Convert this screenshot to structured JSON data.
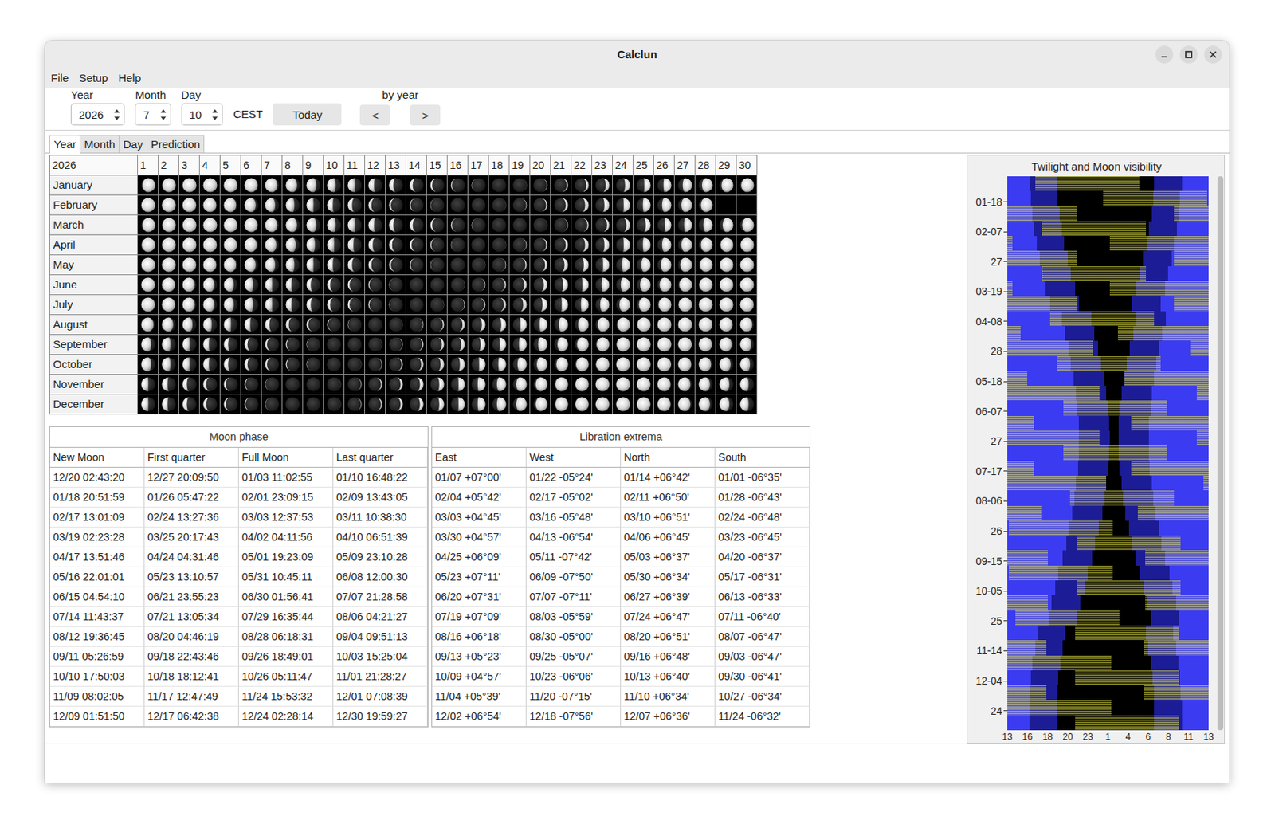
{
  "window": {
    "title": "Calclun"
  },
  "menu": [
    "File",
    "Setup",
    "Help"
  ],
  "toolbar": {
    "fields": [
      {
        "label": "Year",
        "value": "2026"
      },
      {
        "label": "Month",
        "value": "7"
      },
      {
        "label": "Day",
        "value": "10"
      }
    ],
    "timezone": "CEST",
    "today_button": "Today",
    "by_year": {
      "label": "by year",
      "prev": "<",
      "next": ">"
    }
  },
  "tabs": [
    {
      "label": "Year",
      "selected": true
    },
    {
      "label": "Month",
      "selected": false
    },
    {
      "label": "Day",
      "selected": false
    },
    {
      "label": "Prediction",
      "selected": false
    }
  ],
  "year_grid": {
    "corner": "2026",
    "days": [
      "1",
      "2",
      "3",
      "4",
      "5",
      "6",
      "7",
      "8",
      "9",
      "10",
      "11",
      "12",
      "13",
      "14",
      "15",
      "16",
      "17",
      "18",
      "19",
      "20",
      "21",
      "22",
      "23",
      "24",
      "25",
      "26",
      "27",
      "28",
      "29",
      "30"
    ],
    "months": [
      {
        "name": "January",
        "ages": [
          12,
          13,
          14,
          15,
          16,
          17,
          18,
          19,
          20,
          21,
          22,
          23,
          24,
          25,
          26,
          27,
          28,
          29,
          1,
          2,
          3,
          4,
          5,
          6,
          7,
          8,
          9,
          10,
          11,
          12
        ]
      },
      {
        "name": "February",
        "ages": [
          14,
          15,
          16,
          17,
          18,
          19,
          20,
          21,
          22,
          23,
          24,
          25,
          26,
          27,
          28,
          29,
          0,
          1,
          2,
          3,
          4,
          5,
          6,
          7,
          8,
          9,
          10,
          11,
          null,
          null
        ]
      },
      {
        "name": "March",
        "ages": [
          12,
          13,
          14,
          15,
          16,
          17,
          18,
          19,
          20,
          21,
          22,
          23,
          24,
          25,
          26,
          27,
          28,
          29,
          0,
          1,
          2,
          3,
          4,
          5,
          6,
          7,
          8,
          9,
          10,
          11
        ]
      },
      {
        "name": "April",
        "ages": [
          13,
          14,
          15,
          16,
          17,
          18,
          19,
          20,
          21,
          22,
          23,
          24,
          25,
          26,
          27,
          28,
          29,
          1,
          2,
          3,
          4,
          5,
          6,
          7,
          8,
          9,
          10,
          11,
          12,
          13
        ]
      },
      {
        "name": "May",
        "ages": [
          14,
          15,
          16,
          17,
          18,
          19,
          20,
          21,
          22,
          23,
          24,
          25,
          26,
          27,
          28,
          29,
          1,
          2,
          3,
          4,
          5,
          6,
          7,
          8,
          9,
          10,
          11,
          12,
          13,
          14
        ]
      },
      {
        "name": "June",
        "ages": [
          16,
          17,
          18,
          19,
          20,
          21,
          22,
          23,
          24,
          25,
          26,
          27,
          28,
          29,
          0,
          1,
          2,
          3,
          4,
          5,
          6,
          7,
          8,
          9,
          10,
          11,
          12,
          13,
          14,
          15
        ]
      },
      {
        "name": "July",
        "ages": [
          16,
          17,
          18,
          19,
          20,
          21,
          22,
          23,
          24,
          25,
          26,
          27,
          28,
          0,
          1,
          2,
          3,
          4,
          5,
          6,
          7,
          8,
          9,
          10,
          11,
          12,
          13,
          14,
          15,
          16
        ]
      },
      {
        "name": "August",
        "ages": [
          18,
          19,
          20,
          21,
          22,
          23,
          24,
          25,
          26,
          27,
          28,
          29,
          1,
          2,
          3,
          4,
          5,
          6,
          7,
          8,
          9,
          10,
          11,
          12,
          13,
          14,
          15,
          16,
          17,
          18
        ]
      },
      {
        "name": "September",
        "ages": [
          20,
          21,
          22,
          23,
          24,
          25,
          26,
          27,
          28,
          29,
          0,
          1,
          2,
          3,
          4,
          5,
          6,
          7,
          8,
          9,
          10,
          11,
          12,
          13,
          14,
          15,
          16,
          17,
          18,
          19
        ]
      },
      {
        "name": "October",
        "ages": [
          20,
          21,
          22,
          23,
          24,
          25,
          26,
          27,
          28,
          29,
          1,
          2,
          3,
          4,
          5,
          6,
          7,
          8,
          9,
          10,
          11,
          12,
          13,
          14,
          15,
          16,
          17,
          18,
          19,
          20
        ]
      },
      {
        "name": "November",
        "ages": [
          22,
          23,
          24,
          25,
          26,
          27,
          28,
          29,
          0,
          1,
          2,
          3,
          4,
          5,
          6,
          7,
          8,
          9,
          10,
          11,
          12,
          13,
          14,
          15,
          16,
          17,
          18,
          19,
          20,
          21
        ]
      },
      {
        "name": "December",
        "ages": [
          22,
          23,
          24,
          25,
          26,
          27,
          28,
          29,
          0,
          1,
          2,
          3,
          4,
          5,
          6,
          7,
          8,
          9,
          10,
          11,
          12,
          13,
          14,
          15,
          16,
          17,
          18,
          19,
          20,
          21
        ]
      }
    ]
  },
  "moon_phase": {
    "title": "Moon phase",
    "columns": [
      "New Moon",
      "First quarter",
      "Full Moon",
      "Last quarter"
    ],
    "rows": [
      [
        "12/20 02:43:20",
        "12/27 20:09:50",
        "01/03 11:02:55",
        "01/10 16:48:22"
      ],
      [
        "01/18 20:51:59",
        "01/26 05:47:22",
        "02/01 23:09:15",
        "02/09 13:43:05"
      ],
      [
        "02/17 13:01:09",
        "02/24 13:27:36",
        "03/03 12:37:53",
        "03/11 10:38:30"
      ],
      [
        "03/19 02:23:28",
        "03/25 20:17:43",
        "04/02 04:11:56",
        "04/10 06:51:39"
      ],
      [
        "04/17 13:51:46",
        "04/24 04:31:46",
        "05/01 19:23:09",
        "05/09 23:10:28"
      ],
      [
        "05/16 22:01:01",
        "05/23 13:10:57",
        "05/31 10:45:11",
        "06/08 12:00:30"
      ],
      [
        "06/15 04:54:10",
        "06/21 23:55:23",
        "06/30 01:56:41",
        "07/07 21:28:58"
      ],
      [
        "07/14 11:43:37",
        "07/21 13:05:34",
        "07/29 16:35:44",
        "08/06 04:21:27"
      ],
      [
        "08/12 19:36:45",
        "08/20 04:46:19",
        "08/28 06:18:31",
        "09/04 09:51:13"
      ],
      [
        "09/11 05:26:59",
        "09/18 22:43:46",
        "09/26 18:49:01",
        "10/03 15:25:04"
      ],
      [
        "10/10 17:50:03",
        "10/18 18:12:41",
        "10/26 05:11:47",
        "11/01 21:28:27"
      ],
      [
        "11/09 08:02:05",
        "11/17 12:47:49",
        "11/24 15:53:32",
        "12/01 07:08:39"
      ],
      [
        "12/09 01:51:50",
        "12/17 06:42:38",
        "12/24 02:28:14",
        "12/30 19:59:27"
      ]
    ]
  },
  "libration": {
    "title": "Libration extrema",
    "columns": [
      "East",
      "West",
      "North",
      "South"
    ],
    "rows": [
      [
        "01/07 +07°00'",
        "01/22 -05°24'",
        "01/14 +06°42'",
        "01/01 -06°35'"
      ],
      [
        "02/04 +05°42'",
        "02/17 -05°02'",
        "02/11 +06°50'",
        "01/28 -06°43'"
      ],
      [
        "03/03 +04°45'",
        "03/16 -05°48'",
        "03/10 +06°51'",
        "02/24 -06°48'"
      ],
      [
        "03/30 +04°57'",
        "04/13 -06°54'",
        "04/06 +06°45'",
        "03/23 -06°45'"
      ],
      [
        "04/25 +06°09'",
        "05/11 -07°42'",
        "05/03 +06°37'",
        "04/20 -06°37'"
      ],
      [
        "05/23 +07°11'",
        "06/09 -07°50'",
        "05/30 +06°34'",
        "05/17 -06°31'"
      ],
      [
        "06/20 +07°31'",
        "07/07 -07°11'",
        "06/27 +06°39'",
        "06/13 -06°33'"
      ],
      [
        "07/19 +07°09'",
        "08/03 -05°59'",
        "07/24 +06°47'",
        "07/11 -06°40'"
      ],
      [
        "08/16 +06°18'",
        "08/30 -05°00'",
        "08/20 +06°51'",
        "08/07 -06°47'"
      ],
      [
        "09/13 +05°23'",
        "09/25 -05°07'",
        "09/16 +06°48'",
        "09/03 -06°47'"
      ],
      [
        "10/09 +04°57'",
        "10/23 -06°06'",
        "10/13 +06°40'",
        "09/30 -06°41'"
      ],
      [
        "11/04 +05°39'",
        "11/20 -07°15'",
        "11/10 +06°34'",
        "10/27 -06°34'"
      ],
      [
        "12/02 +06°54'",
        "12/18 -07°56'",
        "12/07 +06°36'",
        "11/24 -06°32'"
      ]
    ]
  },
  "twilight_chart": {
    "title": "Twilight and Moon visibility",
    "y_ticks": [
      "01-18",
      "02-07",
      "27",
      "03-19",
      "04-08",
      "28",
      "05-18",
      "06-07",
      "27",
      "07-17",
      "08-06",
      "26",
      "09-15",
      "10-05",
      "25",
      "11-14",
      "12-04",
      "24"
    ],
    "x_ticks": [
      "13",
      "16",
      "18",
      "20",
      "23",
      "1",
      "4",
      "6",
      "8",
      "11",
      "13"
    ],
    "series": {
      "sunset": [
        2.7,
        2.8,
        3.0,
        3.2,
        3.5,
        3.9,
        4.2,
        4.6,
        5.1,
        6.5,
        6.9,
        7.3,
        7.6,
        7.9,
        8.2,
        8.3,
        8.5,
        8.5,
        8.5,
        8.4,
        8.2,
        8.0,
        7.7,
        7.3,
        7.0,
        6.6,
        6.1,
        5.7,
        5.3,
        4.9,
        3.6,
        3.3,
        3.0,
        2.8,
        2.7,
        2.6,
        2.6
      ],
      "dark": [
        5.9,
        6.0,
        6.2,
        6.5,
        6.8,
        7.2,
        7.6,
        8.1,
        8.5,
        10.0,
        10.4,
        10.8,
        11.2,
        11.5,
        11.8,
        12.0,
        12.1,
        12.2,
        12.1,
        12.0,
        11.8,
        11.6,
        11.3,
        10.9,
        10.5,
        10.1,
        9.6,
        9.2,
        8.7,
        8.3,
        6.9,
        6.6,
        6.3,
        6.1,
        5.9,
        5.9,
        5.9
      ],
      "dawn": [
        17.5,
        17.4,
        17.2,
        16.9,
        16.6,
        16.2,
        15.8,
        15.3,
        14.9,
        15.4,
        15.0,
        14.6,
        14.2,
        13.9,
        13.6,
        13.4,
        13.3,
        13.3,
        13.3,
        13.4,
        13.6,
        13.8,
        14.1,
        14.5,
        14.9,
        15.3,
        15.8,
        16.3,
        16.7,
        17.1,
        16.5,
        16.8,
        17.1,
        17.3,
        17.5,
        17.5,
        17.5
      ],
      "sunrise": [
        20.8,
        20.6,
        20.5,
        20.2,
        19.9,
        19.6,
        19.2,
        18.8,
        18.3,
        18.9,
        18.5,
        18.1,
        17.8,
        17.5,
        17.2,
        17.1,
        16.9,
        16.9,
        16.9,
        17.0,
        17.2,
        17.4,
        17.7,
        18.1,
        18.4,
        18.8,
        19.3,
        19.7,
        20.1,
        20.5,
        19.8,
        20.1,
        20.4,
        20.6,
        20.7,
        20.8,
        20.8
      ],
      "moon_rise": [
        3.3,
        11.4,
        19.9,
        4.1,
        12.2,
        19.9,
        4.1,
        12.2,
        19.9,
        5.1,
        13.2,
        21.8,
        5.9,
        14.0,
        22.6,
        6.7,
        14.8,
        22.6,
        6.7,
        14.8,
        23.4,
        7.5,
        15.6,
        0.2,
        8.3,
        16.4,
        0.2,
        8.3,
        16.4,
        1.0,
        8.1,
        16.3,
        0.0,
        8.1,
        16.3,
        0.0,
        8.1
      ],
      "moon_set": [
        15.7,
        23.8,
        8.3,
        16.5,
        0.6,
        8.3,
        16.5,
        0.6,
        8.3,
        17.5,
        1.6,
        10.2,
        18.3,
        2.4,
        11.0,
        19.1,
        3.2,
        11.0,
        19.1,
        3.2,
        11.8,
        19.9,
        4.0,
        12.6,
        20.7,
        4.8,
        12.6,
        20.7,
        4.8,
        13.4,
        20.5,
        4.7,
        12.4,
        20.5,
        4.7,
        12.4,
        20.5
      ]
    }
  }
}
